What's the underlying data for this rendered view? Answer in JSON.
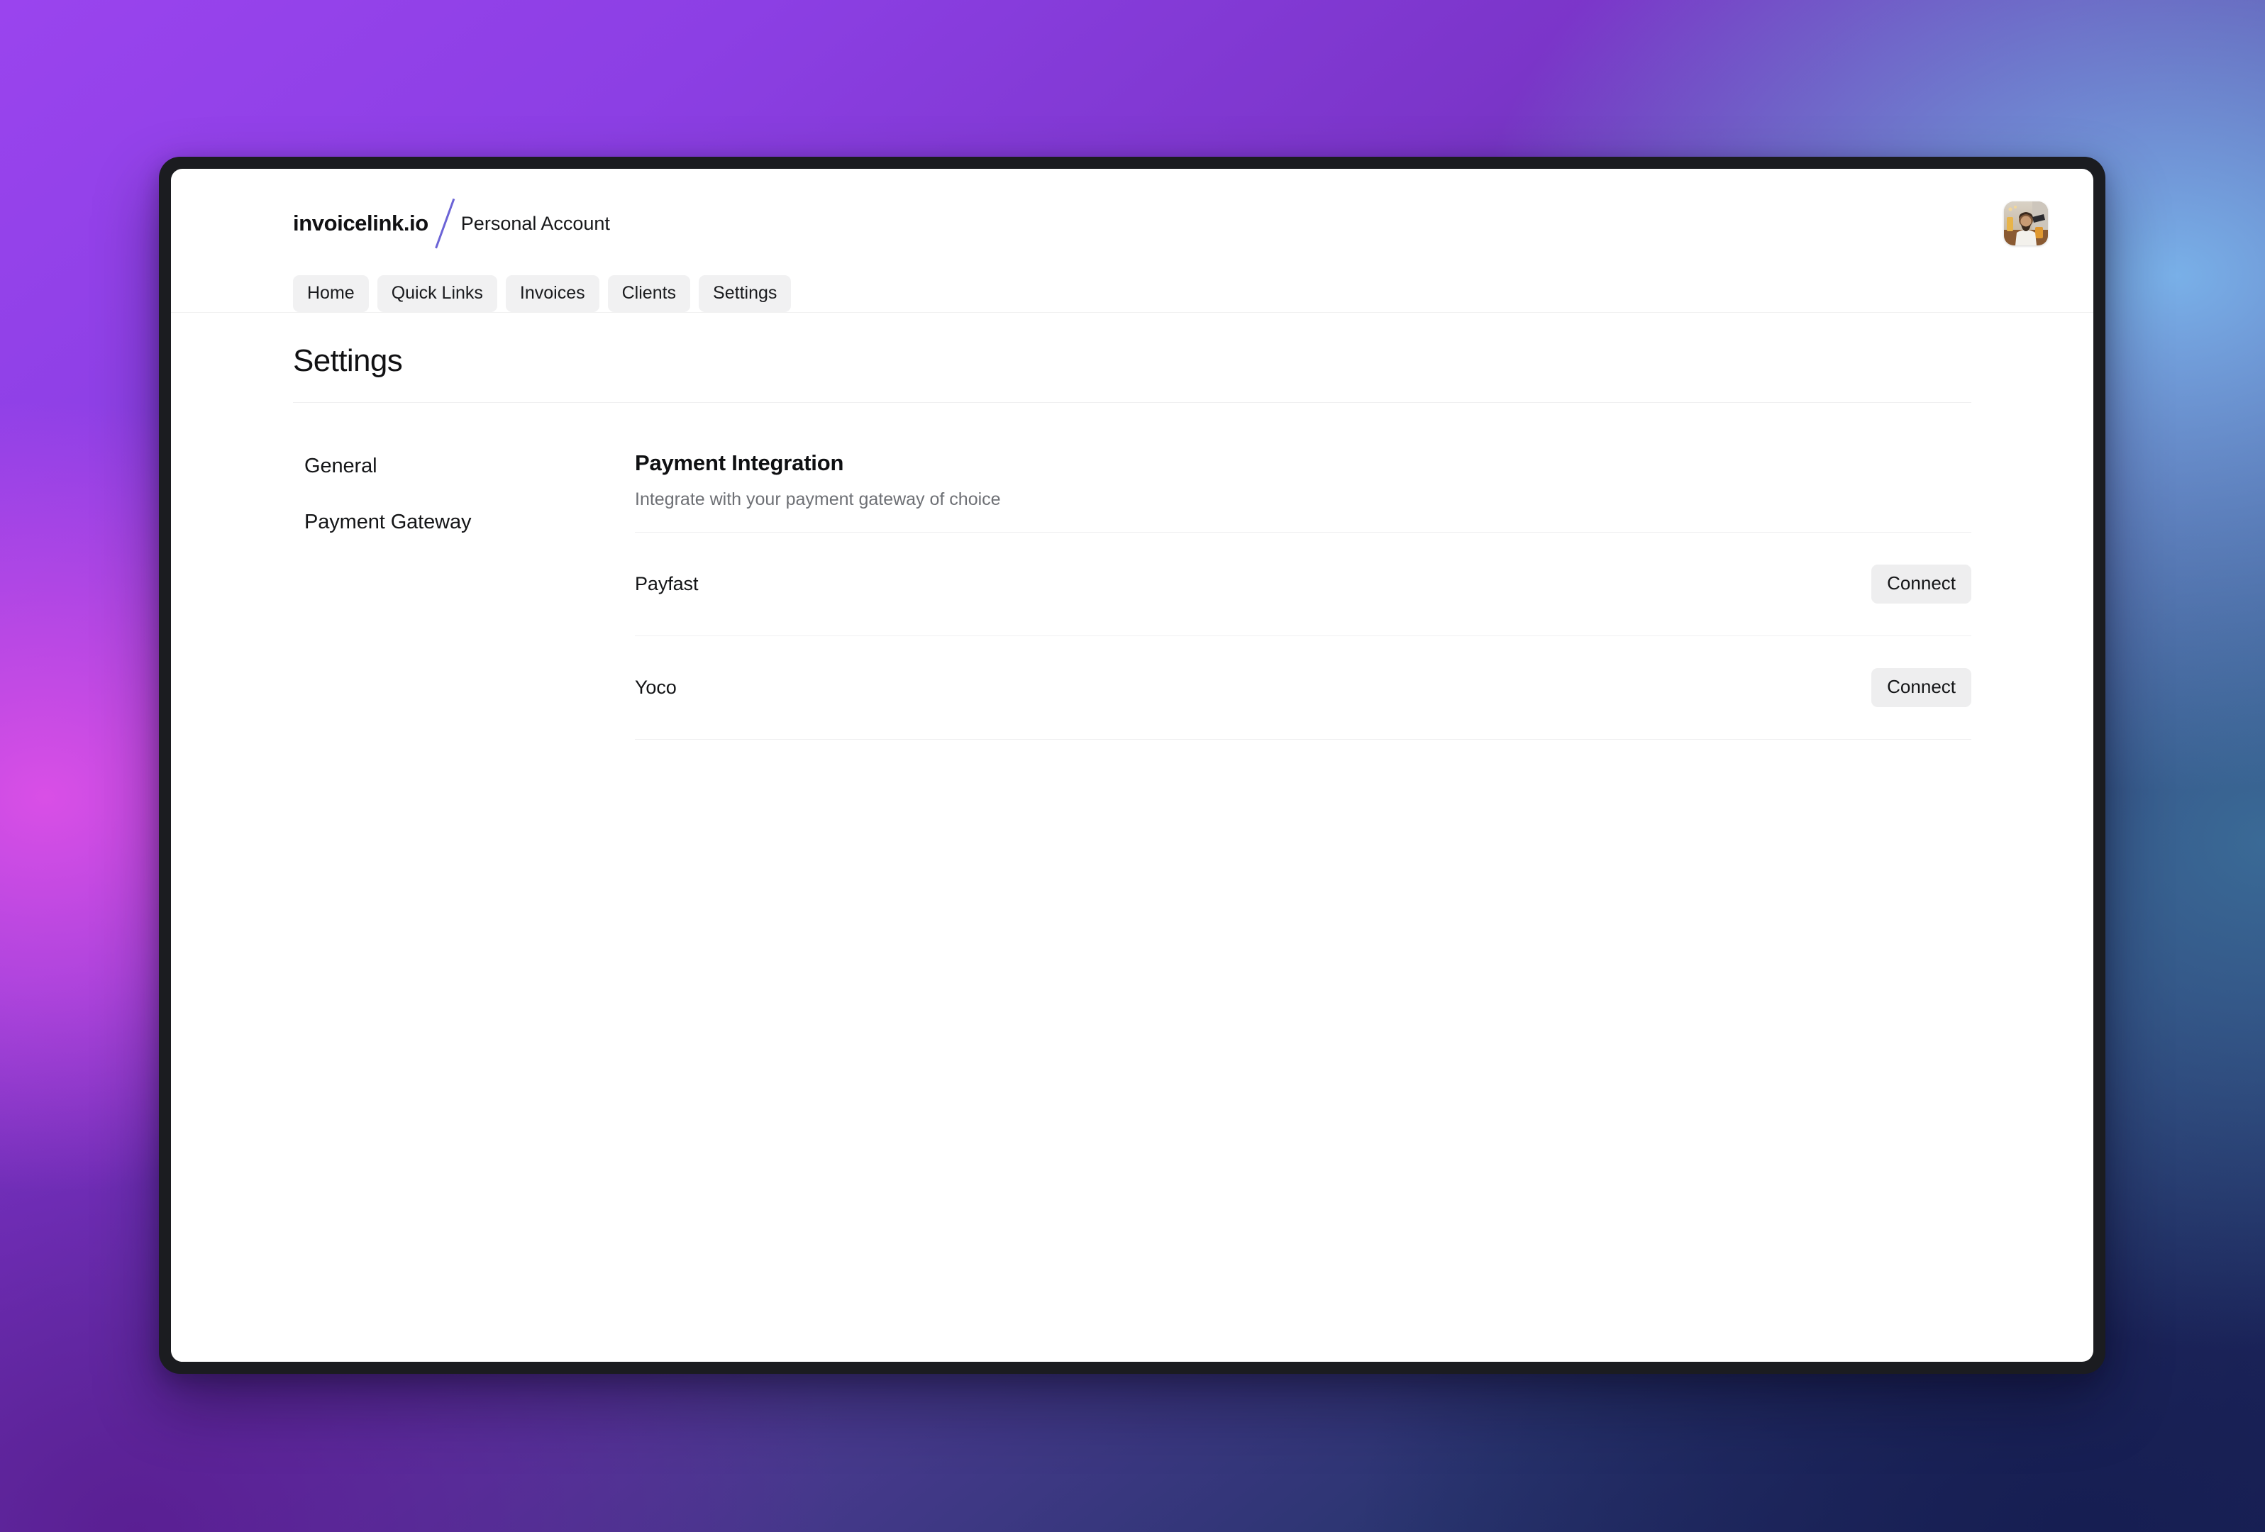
{
  "header": {
    "brand": "invoicelink.io",
    "account": "Personal Account",
    "avatar_alt": "user-avatar"
  },
  "nav": {
    "items": [
      {
        "label": "Home"
      },
      {
        "label": "Quick Links"
      },
      {
        "label": "Invoices"
      },
      {
        "label": "Clients"
      },
      {
        "label": "Settings"
      }
    ]
  },
  "page": {
    "title": "Settings"
  },
  "sidebar": {
    "items": [
      {
        "label": "General"
      },
      {
        "label": "Payment Gateway"
      }
    ]
  },
  "panel": {
    "title": "Payment Integration",
    "subtitle": "Integrate with your payment gateway of choice",
    "gateways": [
      {
        "name": "Payfast",
        "action": "Connect"
      },
      {
        "name": "Yoco",
        "action": "Connect"
      }
    ]
  },
  "colors": {
    "accent_slash": "#6b63d6",
    "pill_bg": "#f1f1f2",
    "button_bg": "#eeeeef",
    "divider": "#f0f0f1",
    "text_primary": "#111113",
    "text_muted": "#6e7075",
    "frame": "#1b1c20",
    "bg_purple": "#9a44ee",
    "bg_magenta": "#d94fe6",
    "bg_sky": "#79b0e8",
    "bg_steel": "#3a6a96",
    "bg_navy": "#1b2257"
  }
}
